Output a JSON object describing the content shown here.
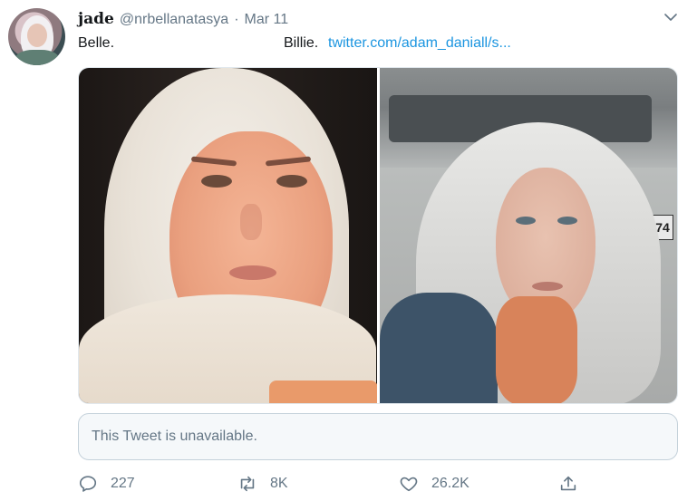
{
  "tweet": {
    "display_name": "jade",
    "handle": "@nrbellanatasya",
    "separator": "·",
    "date": "Mar 11",
    "text_part1": "Belle.",
    "text_part2": "Billie.",
    "link_text": "twitter.com/adam_daniall/s..."
  },
  "media": {
    "left_photo": "photo-belle",
    "right_photo": "photo-billie",
    "right_photo_sign": "74"
  },
  "quoted_tweet": {
    "unavailable_text": "This Tweet is unavailable."
  },
  "actions": {
    "reply_count": "227",
    "retweet_count": "8K",
    "like_count": "26.2K"
  },
  "icons": {
    "reply": "reply-icon",
    "retweet": "retweet-icon",
    "like": "heart-icon",
    "share": "share-icon",
    "caret": "chevron-down-icon"
  },
  "colors": {
    "text": "#14171a",
    "secondary": "#657786",
    "link": "#1b95e0",
    "unavailable_bg": "#f5f8fa",
    "border": "#c4d1da"
  }
}
